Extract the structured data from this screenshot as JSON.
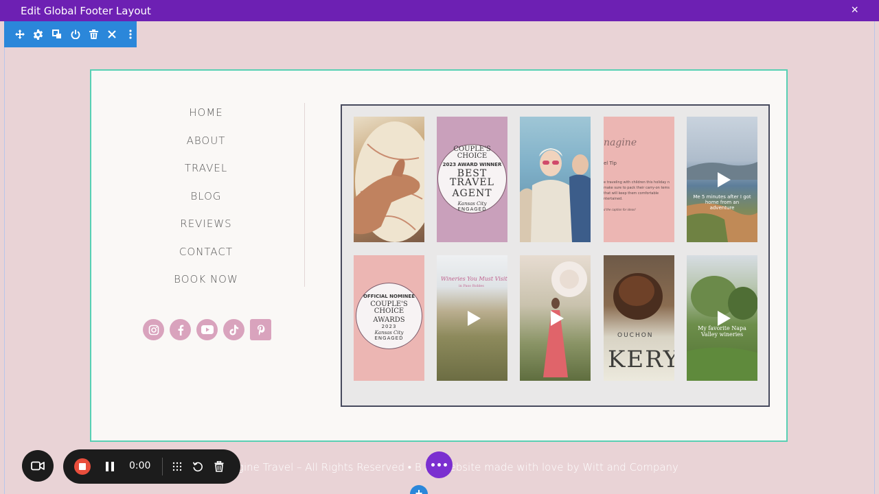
{
  "window": {
    "title": "Edit Global Footer Layout",
    "close_icon": "×"
  },
  "toolbar": {
    "icons": [
      "move-icon",
      "settings-icon",
      "duplicate-icon",
      "power-icon",
      "trash-icon",
      "close-icon",
      "more-icon"
    ]
  },
  "nav": {
    "items": [
      "HOME",
      "ABOUT",
      "TRAVEL",
      "BLOG",
      "REVIEWS",
      "CONTACT",
      "BOOK NOW"
    ]
  },
  "social": {
    "icons": [
      "instagram-icon",
      "facebook-icon",
      "youtube-icon",
      "tiktok-icon",
      "pinterest-icon"
    ],
    "accent_color": "#d9a3bd"
  },
  "feed": {
    "tiles": {
      "badge_award_winner": {
        "line1": "COUPLE'S",
        "line2": "CHOICE",
        "line3": "2023 AWARD WINNER",
        "line4": "BEST TRAVEL",
        "line5": "AGENT",
        "line6": "Kansas City",
        "line7": "ENGAGED"
      },
      "travel_tip": {
        "brand": "nagine",
        "title": "el Tip",
        "body": "e traveling with children this holiday n make sure to pack their carry-on tems that will keep them comfortable ntertained.",
        "footer": "d the caption for ideas!"
      },
      "video_adventure": {
        "caption": "Me 5 minutes after I got home from an adventure"
      },
      "badge_nominee": {
        "line1": "OFFICIAL NOMINEE",
        "line2": "COUPLE'S",
        "line3": "CHOICE",
        "line4": "AWARDS",
        "line5": "2023",
        "line6": "Kansas City",
        "line7": "ENGAGED"
      },
      "video_wineries": {
        "title": "Wineries You Must Visit",
        "subtitle": "in Paso Robles"
      },
      "video_napa": {
        "caption": "My favorite Napa Valley wineries"
      },
      "bakery": {
        "sign": "KERY",
        "sign_top": "OUCHON"
      }
    }
  },
  "footer": {
    "text": "gine Travel – All Rights Reserved  •  B        nd website made with love by Witt and Company"
  },
  "recorder": {
    "time": "0:00"
  },
  "colors": {
    "topbar": "#6d20b3",
    "toolbar": "#2b87da",
    "section_border": "#57d0b3",
    "page_bg": "#e9d3d6",
    "record": "#e94e3c"
  }
}
